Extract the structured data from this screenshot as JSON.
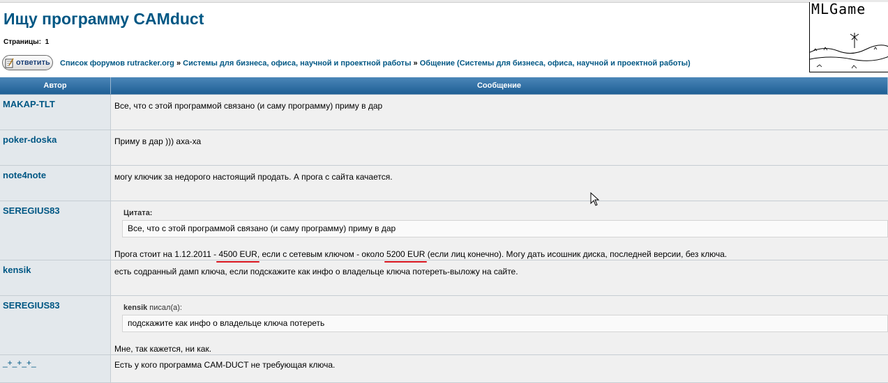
{
  "topic": {
    "title": "Ищу программу CAMduct",
    "pages_label": "Страницы:",
    "pages_value": "1"
  },
  "toolbar": {
    "reply_label": "ответить"
  },
  "breadcrumb": {
    "items": [
      "Список форумов rutracker.org",
      "Системы для бизнеса, офиса, научной и проектной работы",
      "Общение (Системы для бизнеса, офиса, научной и проектной работы)"
    ],
    "separator": "»"
  },
  "banner": {
    "text": "MLGame"
  },
  "table": {
    "col_author": "Автор",
    "col_message": "Сообщение"
  },
  "posts": [
    {
      "author": "MAKAP-TLT",
      "text": "Все, что с этой программой связано (и саму программу) приму в дар"
    },
    {
      "author": "poker-doska",
      "text": "Приму в дар ))) аха-ха"
    },
    {
      "author": "note4note",
      "text": "могу ключик за недорого настоящий продать. А прога с сайта качается."
    },
    {
      "author": "SEREGIUS83",
      "quote_label": "Цитата:",
      "quote_text": "Все, что с этой программой связано (и саму программу) приму в дар",
      "text_a": "Прога стоит на 1.12.2011 - ",
      "highlight_1": "4500 EUR",
      "text_b": ", если с сетевым ключом - около ",
      "highlight_2": "5200 EUR",
      "text_c": " (если лиц конечно). Могу дать исошник диска, последней версии, без ключа."
    },
    {
      "author": "kensik",
      "text": "есть содранный дамп ключа, если подскажите как инфо о владельце ключа потереть-выложу на сайте."
    },
    {
      "author": "SEREGIUS83",
      "quote_author": "kensik",
      "quote_wrote": " писал(а):",
      "quote_text": "подскажите как инфо о владельце ключа потереть",
      "text": "Мне, так кажется, ни как."
    },
    {
      "author": "_+_+_+_",
      "text": "Есть у кого программа CAM-DUCT не требующая ключа."
    }
  ],
  "colors": {
    "link": "#005784",
    "header_bg": "#2b6aa0",
    "author_bg": "#e3e8ec",
    "message_bg": "#f0f0f0",
    "annotation": "#d8141e"
  }
}
